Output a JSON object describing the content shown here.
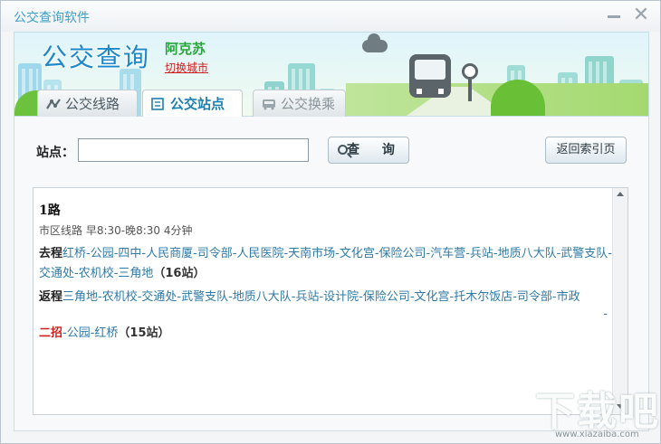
{
  "window": {
    "title": "公交查询软件"
  },
  "banner": {
    "title": "公交查询",
    "city": "阿克苏",
    "switch_city": "切换城市"
  },
  "tabs": [
    {
      "label": "公交线路",
      "icon": "route-icon"
    },
    {
      "label": "公交站点",
      "icon": "stop-list-icon",
      "active": true
    },
    {
      "label": "公交换乘",
      "icon": "bus-transfer-icon"
    }
  ],
  "search": {
    "label": "站点：",
    "value": "",
    "button_label": "查 询",
    "back_label": "返回索引页"
  },
  "result": {
    "route_name": "1路",
    "route_meta": "市区线路 早8:30-晚8:30 4分钟",
    "outbound_label": "去程",
    "outbound_stops": "红桥-公园-四中-人民商厦-司令部-人民医院-天南市场-文化宫-保险公司-汽车营-兵站-地质八大队-武警支队-交通处-农机校-三角地",
    "outbound_count": "（16站）",
    "return_label": "返程",
    "return_stops": "三角地-农机校-交通处-武警支队-地质八大队-兵站-设计院-保险公司-文化宫-托木尔饭店-司令部-市政",
    "return_wrap": "-",
    "branch_label": "二招",
    "branch_stops": "-公园-红桥",
    "branch_count": "（15站）"
  },
  "watermark": {
    "text": "下载吧",
    "url": "www.xiazaiba.com"
  },
  "colors": {
    "title": "#3aa0c7",
    "banner_title": "#1e88c8",
    "city": "#2aa53b",
    "link_red": "#d01f1f",
    "stop_blue": "#2f7aa6"
  }
}
